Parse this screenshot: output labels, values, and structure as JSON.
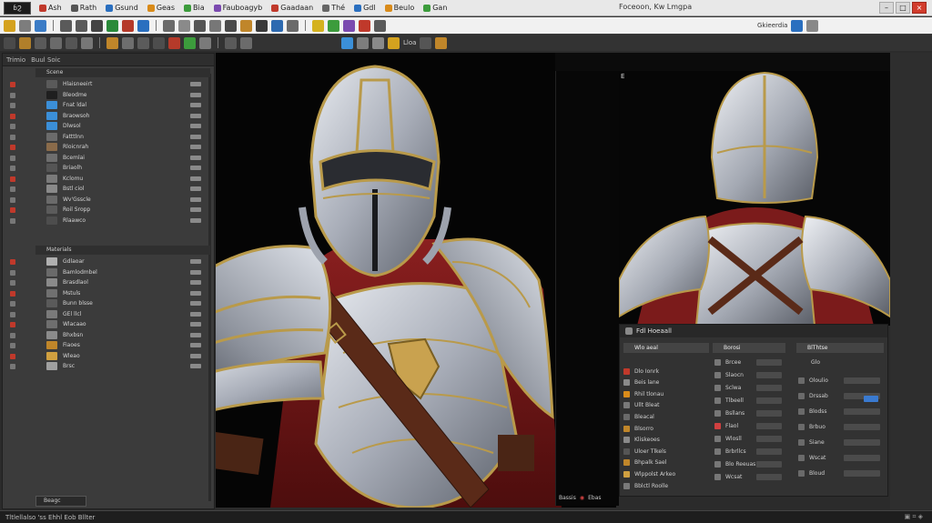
{
  "menubar": {
    "logo": "ɓϨ",
    "items": [
      {
        "label": "Ash",
        "icon": "file-icon",
        "color": "#c0392b"
      },
      {
        "label": "Rath",
        "icon": "edit-icon",
        "color": "#555555"
      },
      {
        "label": "Gsund",
        "icon": "view-icon",
        "color": "#2a6fbf"
      },
      {
        "label": "Geas",
        "icon": "create-icon",
        "color": "#d98b1a"
      },
      {
        "label": "Bia",
        "icon": "modify-icon",
        "color": "#3c9c3c"
      },
      {
        "label": "Fauboagyb",
        "icon": "animation-icon",
        "color": "#7b4ab0"
      },
      {
        "label": "Gaadaan",
        "icon": "render-icon",
        "color": "#c0392b"
      },
      {
        "label": "Thé",
        "icon": "tools-icon",
        "color": "#666666"
      },
      {
        "label": "Gdl",
        "icon": "window-icon",
        "color": "#2a6fbf"
      },
      {
        "label": "Beulo",
        "icon": "help-icon",
        "color": "#d98b1a"
      },
      {
        "label": "Gan",
        "icon": "gear-icon",
        "color": "#3c9c3c"
      }
    ],
    "title": "Foceoon, Kw Lmgpa",
    "window_controls": [
      "–",
      "□",
      "×"
    ]
  },
  "toolbar": {
    "row1_labels": [
      "Gkieerdia",
      "Ruoowssegh"
    ],
    "row2_labels": [
      "Lloa",
      "Rase"
    ]
  },
  "outliner": {
    "header_tabs": [
      "Trimio",
      "Buul Soic"
    ],
    "section1_title": "Scene",
    "rows1": [
      {
        "label": "Hlaisneeirt",
        "thumb": "#5a5a5a"
      },
      {
        "label": "Bleodme",
        "thumb": "#1f1f1f"
      },
      {
        "label": "Fnat ldal",
        "thumb": "#3b8fd8"
      },
      {
        "label": "Braowsoh",
        "thumb": "#3b8fd8"
      },
      {
        "label": "Dlwsol",
        "thumb": "#3b8fd8"
      },
      {
        "label": "Fatttlnn",
        "thumb": "#6b6b6b"
      },
      {
        "label": "Rloicnrah",
        "thumb": "#8a6b4a"
      },
      {
        "label": "Bcemlai",
        "thumb": "#6e6e6e"
      },
      {
        "label": "Briaolh",
        "thumb": "#555555"
      },
      {
        "label": "Kclomu",
        "thumb": "#7a7a7a"
      },
      {
        "label": "Bstl ciol",
        "thumb": "#8a8a8a"
      },
      {
        "label": "Wv'Gsscle",
        "thumb": "#6a6a6a"
      },
      {
        "label": "Roil Sropp",
        "thumb": "#5b5b5b"
      },
      {
        "label": "Rlaawco",
        "thumb": "#4d4d4d"
      }
    ],
    "section2_title": "Materials",
    "rows2": [
      {
        "label": "Gdlaoar",
        "thumb": "#b0b0b0"
      },
      {
        "label": "Bamlodmbel",
        "thumb": "#6a6a6a"
      },
      {
        "label": "Brasdlaol",
        "thumb": "#8a8a8a"
      },
      {
        "label": "Mstuls",
        "thumb": "#707070"
      },
      {
        "label": "Bunn blsse",
        "thumb": "#5a5a5a"
      },
      {
        "label": "GEl llcl",
        "thumb": "#7a7a7a"
      },
      {
        "label": "Wlacaao",
        "thumb": "#6e6e6e"
      },
      {
        "label": "Bhxbsn",
        "thumb": "#8b8b8b"
      },
      {
        "label": "Fiaoes",
        "thumb": "#c0862a"
      },
      {
        "label": "Wleao",
        "thumb": "#d0a040"
      },
      {
        "label": "Brsc",
        "thumb": "#a0a0a0"
      }
    ],
    "footer_button": "Beagc"
  },
  "viewport": {
    "bottom_tools": [
      "Bassis",
      "◉",
      "Ebas"
    ]
  },
  "viewport2": {
    "label": "E"
  },
  "props": {
    "title": "Fdl Hoeaall",
    "col1_header": "Wlo aeal",
    "col2_header": "Borosi",
    "col3_header": "BlThtse",
    "col3_value": "Glo",
    "rows_left": [
      "Dlo Ionrk",
      "Beis lane",
      "Rhil tlonau",
      "Ullt Bleat",
      "Bleacal",
      "Blsorro",
      "Kliskeoes",
      "Uloer Tlkels",
      "Bhpalk Sael",
      "Wlppolst Arkeo",
      "Bblctl Roolle"
    ],
    "rows_mid": [
      "Brcee",
      "Slaocn",
      "Sclwa",
      "Tlbeell",
      "Bsllans",
      "Flaol",
      "Wlosll",
      "Brbrllcs",
      "Blo Reeuas",
      "Wcsat"
    ],
    "rows_right": [
      "Oloulio",
      "Drssab",
      "Blodss",
      "Brbuo",
      "Siane",
      "Wscat",
      "Bloud"
    ]
  },
  "statusbar": {
    "left": "Tltlellalso 'ss  Ehhl  Eob Bllter",
    "right": "▣  ⌗  ◈"
  },
  "colors": {
    "accent_blue": "#3a7ad0",
    "panel_bg": "#3b3b3b",
    "viewport_bg": "#050505",
    "armor_steel": "#c9ccd4",
    "armor_gold": "#b99a4a",
    "cloth_red": "#7a1a1a"
  }
}
